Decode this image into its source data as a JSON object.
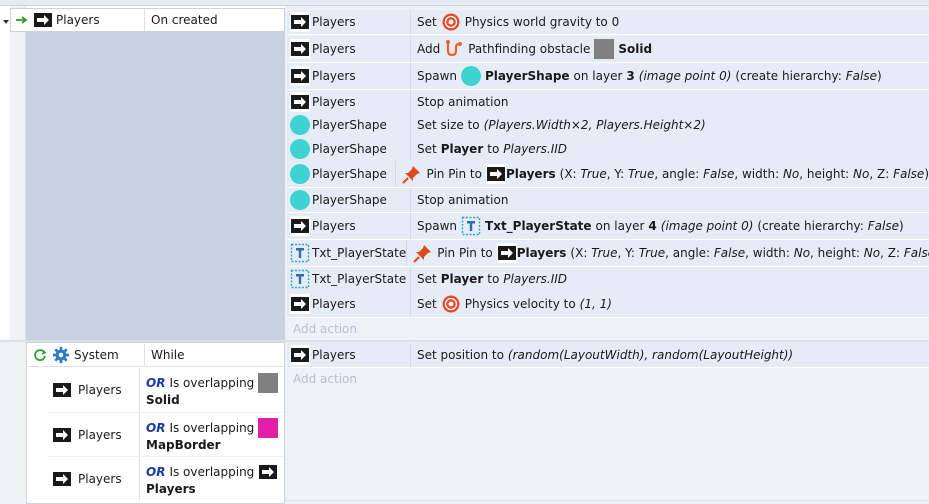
{
  "event1": {
    "condition": {
      "object": "Players",
      "trigger": "On created"
    },
    "actions": [
      {
        "object": "Players",
        "verb": "Set",
        "target": "Physics world gravity to 0"
      },
      {
        "object": "Players",
        "verb": "Add",
        "target": "Pathfinding obstacle",
        "value": "Solid"
      },
      {
        "object": "Players",
        "verb": "Spawn",
        "target": "PlayerShape",
        "p1": "on layer",
        "layer": "3",
        "p2": "(image point 0)",
        "p3": "(create hierarchy:",
        "p3v": "False",
        "p3e": ")"
      },
      {
        "object": "Players",
        "text": "Stop animation"
      },
      {
        "object": "PlayerShape",
        "verb": "Set size to",
        "value": "(Players.Width×2, Players.Height×2)"
      },
      {
        "object": "PlayerShape",
        "verb": "Set",
        "target": "Player",
        "mid": "to",
        "value": "Players.IID"
      },
      {
        "object": "PlayerShape",
        "verb": "Pin Pin to",
        "target": "Players",
        "params": [
          {
            "label": "(X:",
            "value": "True"
          },
          {
            "label": ", Y:",
            "value": "True"
          },
          {
            "label": ", angle:",
            "value": "False"
          },
          {
            "label": ", width:",
            "value": "No"
          },
          {
            "label": ", height:",
            "value": "No"
          },
          {
            "label": ", Z:",
            "value": "False"
          }
        ],
        "close": ")"
      },
      {
        "object": "PlayerShape",
        "text": "Stop animation"
      },
      {
        "object": "Players",
        "verb": "Spawn",
        "target": "Txt_PlayerState",
        "p1": "on layer",
        "layer": "4",
        "p2": "(image point 0)",
        "p3": "(create hierarchy:",
        "p3v": "False",
        "p3e": ")"
      },
      {
        "object": "Txt_PlayerState",
        "verb": "Pin Pin to",
        "target": "Players",
        "params": [
          {
            "label": "(X:",
            "value": "True"
          },
          {
            "label": ", Y:",
            "value": "True"
          },
          {
            "label": ", angle:",
            "value": "False"
          },
          {
            "label": ", width:",
            "value": "No"
          },
          {
            "label": ", height:",
            "value": "No"
          },
          {
            "label": ", Z:",
            "value": "False"
          }
        ],
        "close": ")"
      },
      {
        "object": "Txt_PlayerState",
        "verb": "Set",
        "target": "Player",
        "mid": "to",
        "value": "Players.IID"
      },
      {
        "object": "Players",
        "verb": "Set",
        "target": "Physics velocity to",
        "value": "(1, 1)"
      }
    ],
    "add_action": "Add action"
  },
  "event2": {
    "system": {
      "object": "System",
      "trigger": "While"
    },
    "conditions": [
      {
        "object": "Players",
        "or": "OR",
        "text": "Is overlapping",
        "target": "Solid"
      },
      {
        "object": "Players",
        "or": "OR",
        "text": "Is overlapping",
        "target": "MapBorder"
      },
      {
        "object": "Players",
        "or": "OR",
        "text": "Is overlapping",
        "target": "Players"
      }
    ],
    "action": {
      "object": "Players",
      "verb": "Set position to",
      "value": "(random(LayoutWidth), random(LayoutHeight))"
    },
    "add_action": "Add action"
  },
  "colors": {
    "selected_block": "#c9d2e0",
    "action_row": "#e6ecf6",
    "accent_or": "#1a3ba0",
    "shape_cyan": "#3ed3d3",
    "magenta": "#e21fa8"
  }
}
